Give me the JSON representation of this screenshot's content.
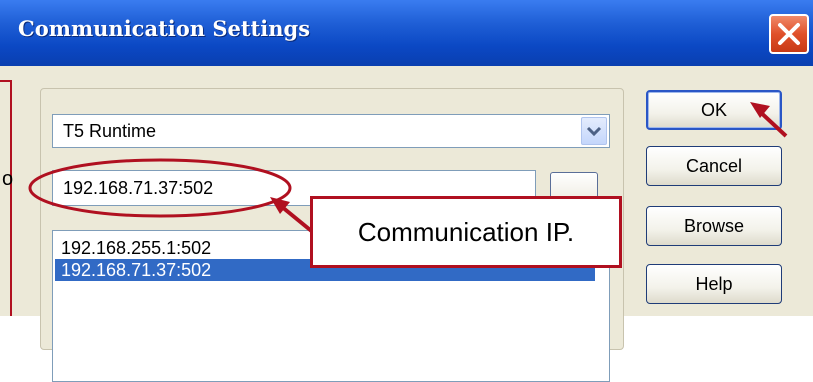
{
  "window": {
    "title": "Communication Settings"
  },
  "runtime_combo": {
    "selected": "T5 Runtime"
  },
  "address_input": {
    "value": "192.168.71.37:502"
  },
  "address_list": {
    "items": [
      {
        "label": "192.168.255.1:502",
        "selected": false
      },
      {
        "label": "192.168.71.37:502",
        "selected": true
      }
    ]
  },
  "buttons": {
    "ok": "OK",
    "cancel": "Cancel",
    "browse": "Browse",
    "help": "Help"
  },
  "annotation": {
    "callout_text": "Communication IP.",
    "edge_text": "o"
  },
  "colors": {
    "title_bar": "#0a48c4",
    "dialog_bg": "#ece9d8",
    "selection": "#316ac5",
    "annotation_red": "#b01020"
  },
  "icons": {
    "close": "close-x-icon",
    "dropdown": "chevron-down-icon"
  }
}
